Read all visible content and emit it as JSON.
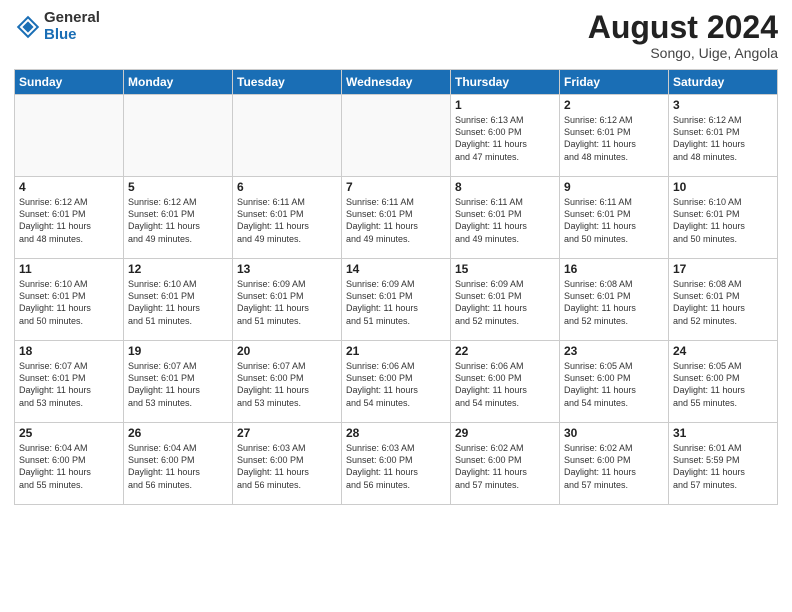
{
  "header": {
    "logo_general": "General",
    "logo_blue": "Blue",
    "month_year": "August 2024",
    "location": "Songo, Uige, Angola"
  },
  "days_of_week": [
    "Sunday",
    "Monday",
    "Tuesday",
    "Wednesday",
    "Thursday",
    "Friday",
    "Saturday"
  ],
  "weeks": [
    [
      {
        "day": "",
        "info": ""
      },
      {
        "day": "",
        "info": ""
      },
      {
        "day": "",
        "info": ""
      },
      {
        "day": "",
        "info": ""
      },
      {
        "day": "1",
        "info": "Sunrise: 6:13 AM\nSunset: 6:00 PM\nDaylight: 11 hours\nand 47 minutes."
      },
      {
        "day": "2",
        "info": "Sunrise: 6:12 AM\nSunset: 6:01 PM\nDaylight: 11 hours\nand 48 minutes."
      },
      {
        "day": "3",
        "info": "Sunrise: 6:12 AM\nSunset: 6:01 PM\nDaylight: 11 hours\nand 48 minutes."
      }
    ],
    [
      {
        "day": "4",
        "info": "Sunrise: 6:12 AM\nSunset: 6:01 PM\nDaylight: 11 hours\nand 48 minutes."
      },
      {
        "day": "5",
        "info": "Sunrise: 6:12 AM\nSunset: 6:01 PM\nDaylight: 11 hours\nand 49 minutes."
      },
      {
        "day": "6",
        "info": "Sunrise: 6:11 AM\nSunset: 6:01 PM\nDaylight: 11 hours\nand 49 minutes."
      },
      {
        "day": "7",
        "info": "Sunrise: 6:11 AM\nSunset: 6:01 PM\nDaylight: 11 hours\nand 49 minutes."
      },
      {
        "day": "8",
        "info": "Sunrise: 6:11 AM\nSunset: 6:01 PM\nDaylight: 11 hours\nand 49 minutes."
      },
      {
        "day": "9",
        "info": "Sunrise: 6:11 AM\nSunset: 6:01 PM\nDaylight: 11 hours\nand 50 minutes."
      },
      {
        "day": "10",
        "info": "Sunrise: 6:10 AM\nSunset: 6:01 PM\nDaylight: 11 hours\nand 50 minutes."
      }
    ],
    [
      {
        "day": "11",
        "info": "Sunrise: 6:10 AM\nSunset: 6:01 PM\nDaylight: 11 hours\nand 50 minutes."
      },
      {
        "day": "12",
        "info": "Sunrise: 6:10 AM\nSunset: 6:01 PM\nDaylight: 11 hours\nand 51 minutes."
      },
      {
        "day": "13",
        "info": "Sunrise: 6:09 AM\nSunset: 6:01 PM\nDaylight: 11 hours\nand 51 minutes."
      },
      {
        "day": "14",
        "info": "Sunrise: 6:09 AM\nSunset: 6:01 PM\nDaylight: 11 hours\nand 51 minutes."
      },
      {
        "day": "15",
        "info": "Sunrise: 6:09 AM\nSunset: 6:01 PM\nDaylight: 11 hours\nand 52 minutes."
      },
      {
        "day": "16",
        "info": "Sunrise: 6:08 AM\nSunset: 6:01 PM\nDaylight: 11 hours\nand 52 minutes."
      },
      {
        "day": "17",
        "info": "Sunrise: 6:08 AM\nSunset: 6:01 PM\nDaylight: 11 hours\nand 52 minutes."
      }
    ],
    [
      {
        "day": "18",
        "info": "Sunrise: 6:07 AM\nSunset: 6:01 PM\nDaylight: 11 hours\nand 53 minutes."
      },
      {
        "day": "19",
        "info": "Sunrise: 6:07 AM\nSunset: 6:01 PM\nDaylight: 11 hours\nand 53 minutes."
      },
      {
        "day": "20",
        "info": "Sunrise: 6:07 AM\nSunset: 6:00 PM\nDaylight: 11 hours\nand 53 minutes."
      },
      {
        "day": "21",
        "info": "Sunrise: 6:06 AM\nSunset: 6:00 PM\nDaylight: 11 hours\nand 54 minutes."
      },
      {
        "day": "22",
        "info": "Sunrise: 6:06 AM\nSunset: 6:00 PM\nDaylight: 11 hours\nand 54 minutes."
      },
      {
        "day": "23",
        "info": "Sunrise: 6:05 AM\nSunset: 6:00 PM\nDaylight: 11 hours\nand 54 minutes."
      },
      {
        "day": "24",
        "info": "Sunrise: 6:05 AM\nSunset: 6:00 PM\nDaylight: 11 hours\nand 55 minutes."
      }
    ],
    [
      {
        "day": "25",
        "info": "Sunrise: 6:04 AM\nSunset: 6:00 PM\nDaylight: 11 hours\nand 55 minutes."
      },
      {
        "day": "26",
        "info": "Sunrise: 6:04 AM\nSunset: 6:00 PM\nDaylight: 11 hours\nand 56 minutes."
      },
      {
        "day": "27",
        "info": "Sunrise: 6:03 AM\nSunset: 6:00 PM\nDaylight: 11 hours\nand 56 minutes."
      },
      {
        "day": "28",
        "info": "Sunrise: 6:03 AM\nSunset: 6:00 PM\nDaylight: 11 hours\nand 56 minutes."
      },
      {
        "day": "29",
        "info": "Sunrise: 6:02 AM\nSunset: 6:00 PM\nDaylight: 11 hours\nand 57 minutes."
      },
      {
        "day": "30",
        "info": "Sunrise: 6:02 AM\nSunset: 6:00 PM\nDaylight: 11 hours\nand 57 minutes."
      },
      {
        "day": "31",
        "info": "Sunrise: 6:01 AM\nSunset: 5:59 PM\nDaylight: 11 hours\nand 57 minutes."
      }
    ]
  ]
}
